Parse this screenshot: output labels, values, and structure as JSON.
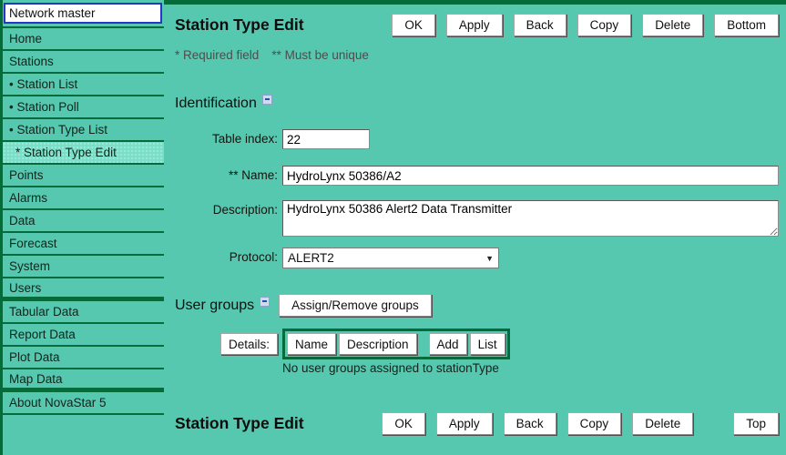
{
  "colors": {
    "background": "#56c8af",
    "divider": "#046b3b",
    "active_item_bg": "#7adec8",
    "selector_border": "#2a35c8"
  },
  "sidebar": {
    "master_selector": "Network master",
    "items": [
      {
        "label": "Home"
      },
      {
        "label": "Stations"
      },
      {
        "label": "• Station List"
      },
      {
        "label": "• Station Poll"
      },
      {
        "label": "• Station Type List"
      },
      {
        "label": "* Station Type Edit"
      },
      {
        "label": "Points"
      },
      {
        "label": "Alarms"
      },
      {
        "label": "Data"
      },
      {
        "label": "Forecast"
      },
      {
        "label": "System"
      },
      {
        "label": "Users"
      },
      {
        "label": "Tabular Data"
      },
      {
        "label": "Report Data"
      },
      {
        "label": "Plot Data"
      },
      {
        "label": "Map Data"
      },
      {
        "label": "About NovaStar 5"
      }
    ]
  },
  "header": {
    "title": "Station Type Edit",
    "buttons": [
      "OK",
      "Apply",
      "Back",
      "Copy",
      "Delete",
      "Bottom"
    ],
    "note_required": "* Required field",
    "note_unique": "** Must be unique"
  },
  "identification": {
    "heading": "Identification",
    "fields": {
      "table_index": {
        "label": "Table index:",
        "value": "22"
      },
      "name": {
        "label": "** Name:",
        "value": "HydroLynx 50386/A2"
      },
      "description": {
        "label": "Description:",
        "value": "HydroLynx 50386 Alert2 Data Transmitter"
      },
      "protocol": {
        "label": "Protocol:",
        "value": "ALERT2"
      }
    }
  },
  "user_groups": {
    "heading": "User groups",
    "assign_button": "Assign/Remove groups",
    "details_label": "Details:",
    "buttons": [
      "Name",
      "Description",
      "Add",
      "List"
    ],
    "empty_message": "No user groups assigned to stationType"
  },
  "footer": {
    "title": "Station Type Edit",
    "buttons": [
      "OK",
      "Apply",
      "Back",
      "Copy",
      "Delete",
      "Top"
    ]
  }
}
